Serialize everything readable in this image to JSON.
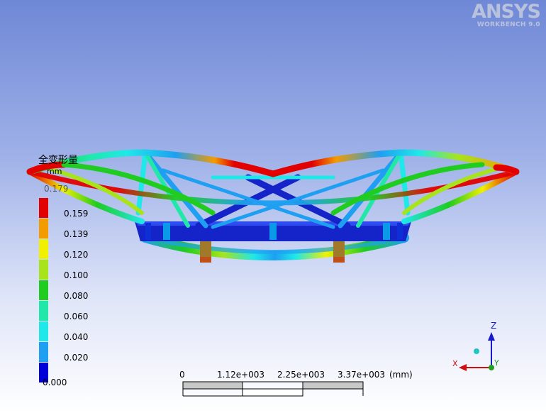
{
  "logo": {
    "brand": "ANSYS",
    "product": "WORKBENCH 9.0"
  },
  "legend": {
    "title": "全变形量",
    "unit": "mm",
    "max_value": "0.179",
    "ticks": [
      "0.159",
      "0.139",
      "0.120",
      "0.100",
      "0.080",
      "0.060",
      "0.040",
      "0.020",
      "0.000"
    ],
    "colors": [
      "#e30000",
      "#f39c00",
      "#f0f000",
      "#a7e41c",
      "#1fcc1f",
      "#21e8a8",
      "#1fe8e8",
      "#1e9ff2",
      "#0000d8"
    ]
  },
  "scale": {
    "labels": [
      "0",
      "1.12e+003",
      "2.25e+003",
      "3.37e+003"
    ],
    "unit": "(mm)"
  },
  "triad": {
    "z": "Z",
    "y": "Y",
    "x": "X"
  },
  "colors": {
    "beam_blue": "#1f2fd0",
    "beam_red": "#e31010"
  }
}
